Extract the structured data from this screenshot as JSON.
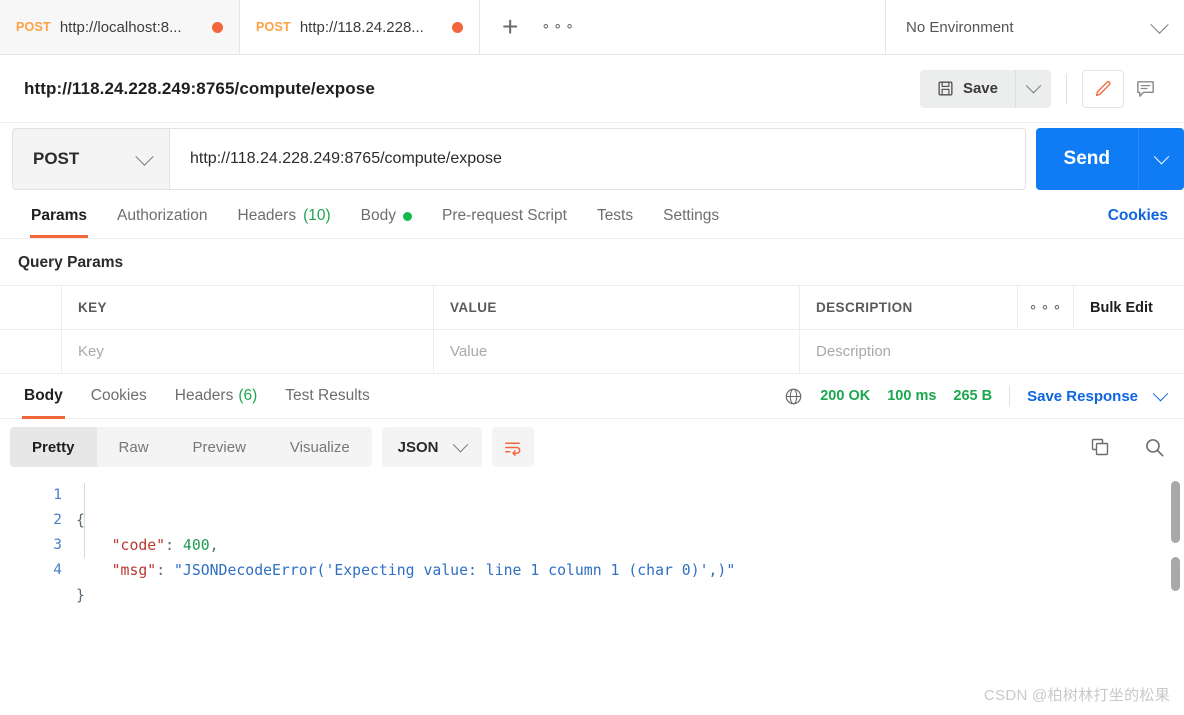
{
  "tabstrip": {
    "tabs": [
      {
        "method": "POST",
        "name": "http://localhost:8...",
        "unsaved": true
      },
      {
        "method": "POST",
        "name": "http://118.24.228...",
        "unsaved": true
      }
    ],
    "new_tab_icon": "plus-icon",
    "more_icon": "ellipsis-icon",
    "environment": "No Environment"
  },
  "request_header": {
    "title": "http://118.24.228.249:8765/compute/expose",
    "save_label": "Save",
    "save_icon": "floppy-disk-icon",
    "save_caret_icon": "chevron-down-icon",
    "edit_icon": "pencil-icon",
    "comment_icon": "comment-icon"
  },
  "url_row": {
    "method": "POST",
    "method_caret_icon": "chevron-down-icon",
    "url": "http://118.24.228.249:8765/compute/expose",
    "send_label": "Send",
    "send_caret_icon": "chevron-down-icon"
  },
  "request_tabs": {
    "items": [
      {
        "label": "Params",
        "active": true
      },
      {
        "label": "Authorization",
        "active": false
      },
      {
        "label": "Headers",
        "count": "(10)",
        "active": false
      },
      {
        "label": "Body",
        "dot": true,
        "active": false
      },
      {
        "label": "Pre-request Script",
        "active": false
      },
      {
        "label": "Tests",
        "active": false
      },
      {
        "label": "Settings",
        "active": false
      }
    ],
    "cookies_label": "Cookies"
  },
  "params": {
    "section_title": "Query Params",
    "headers": {
      "key": "KEY",
      "value": "VALUE",
      "description": "DESCRIPTION"
    },
    "more_icon": "ellipsis-icon",
    "bulk_edit_label": "Bulk Edit",
    "row_placeholders": {
      "key": "Key",
      "value": "Value",
      "description": "Description"
    }
  },
  "response": {
    "tabs": [
      {
        "label": "Body",
        "active": true
      },
      {
        "label": "Cookies",
        "active": false
      },
      {
        "label": "Headers",
        "count": "(6)",
        "active": false
      },
      {
        "label": "Test Results",
        "active": false
      }
    ],
    "globe_icon": "globe-icon",
    "status": "200 OK",
    "time": "100 ms",
    "size": "265 B",
    "save_response_label": "Save Response",
    "save_response_caret_icon": "chevron-down-icon",
    "view_modes": [
      {
        "label": "Pretty",
        "active": true
      },
      {
        "label": "Raw",
        "active": false
      },
      {
        "label": "Preview",
        "active": false
      },
      {
        "label": "Visualize",
        "active": false
      }
    ],
    "format": "JSON",
    "format_caret_icon": "chevron-down-icon",
    "wrap_icon": "word-wrap-icon",
    "copy_icon": "copy-icon",
    "search_icon": "search-icon",
    "code": {
      "line_numbers": [
        "1",
        "2",
        "3",
        "4"
      ],
      "lines": [
        {
          "open_brace": "{"
        },
        {
          "indent": "    ",
          "key": "\"code\"",
          "colon": ": ",
          "num": "400",
          "comma": ","
        },
        {
          "indent": "    ",
          "key": "\"msg\"",
          "colon": ": ",
          "str": "\"JSONDecodeError('Expecting value: line 1 column 1 (char 0)',)\""
        },
        {
          "close_brace": "}"
        }
      ]
    }
  },
  "watermark": "CSDN @柏树林打坐的松果",
  "colors": {
    "accent_orange": "#f2663c",
    "method_orange": "#ffa141",
    "primary_blue": "#0f7bf4",
    "link_blue": "#0f66e0",
    "success_green": "#1ca74f",
    "dot_green": "#14b84b"
  }
}
